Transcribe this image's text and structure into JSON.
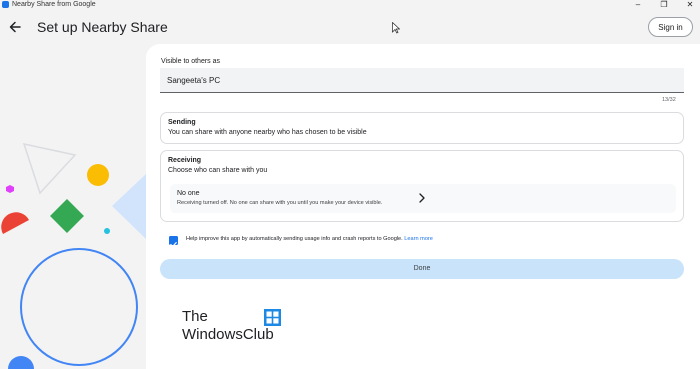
{
  "window": {
    "title": "Nearby Share from Google",
    "controls": [
      "minimize-icon",
      "restore-icon",
      "close-icon"
    ]
  },
  "header": {
    "title": "Set up Nearby Share",
    "sign_in_label": "Sign in"
  },
  "visibility": {
    "label": "Visible to others as",
    "device_name": "Sangeeta's PC",
    "char_counter": "13/32"
  },
  "sending": {
    "title": "Sending",
    "description": "You can share with anyone nearby who has chosen to be visible"
  },
  "receiving": {
    "title": "Receiving",
    "description": "Choose who can share with you",
    "option_title": "No one",
    "option_description": "Receiving turned off. No one can share with you until you make your device visible."
  },
  "consent": {
    "checked": true,
    "text": "Help improve this app by automatically sending usage info and crash reports to Google.",
    "link_label": "Learn more"
  },
  "done_button_label": "Done",
  "watermark": {
    "line1": "The",
    "line2": "WindowsClub",
    "logo": "windows-logo-icon"
  },
  "colors": {
    "accent": "#1a73e8",
    "done_button_bg": "#c8e3fa",
    "page_bg": "#f3f3f3",
    "card_bg": "#ffffff",
    "decor_blue": "#4285f4",
    "decor_green": "#34a853",
    "decor_red": "#ea4335",
    "decor_yellow": "#fbbc04",
    "decor_pink": "#e040fb",
    "decor_cyan": "#24c1e0"
  }
}
